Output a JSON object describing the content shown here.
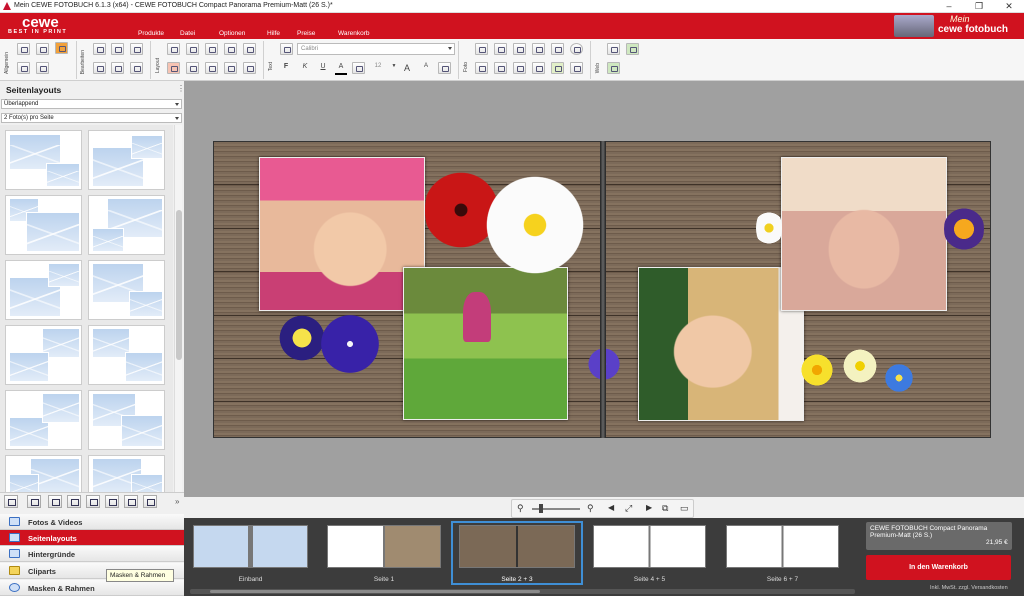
{
  "window": {
    "title": "Mein CEWE FOTOBUCH 6.1.3 (x64) - CEWE FOTOBUCH Compact Panorama Premium-Matt (26 S.)*",
    "minimize": "–",
    "maximize": "❐",
    "close": "✕"
  },
  "brand": {
    "name": "cewe",
    "tagline": "BEST IN PRINT",
    "mein": "Mein",
    "product": "cewe fotobuch",
    "accent": "#d0121f"
  },
  "menu": {
    "items": [
      {
        "label": "Produkte",
        "dropdown": false
      },
      {
        "label": "Datei",
        "dropdown": true
      },
      {
        "label": "Optionen",
        "dropdown": true
      },
      {
        "label": "Hilfe",
        "dropdown": false
      },
      {
        "label": "Preise",
        "dropdown": true
      },
      {
        "label": "Warenkorb",
        "dropdown": false
      }
    ]
  },
  "toolbar": {
    "groups": [
      "Allgemein",
      "Bearbeiten",
      "Layout",
      "Text",
      "Foto",
      "Web"
    ],
    "font_name": "Calibri",
    "font_size": "12",
    "bold": "F",
    "italic": "K",
    "underline": "U",
    "font_color": "A",
    "grow": "A",
    "shrink": "A"
  },
  "left_panel": {
    "title": "Seitenlayouts",
    "layout_mode": "Überlappend",
    "photos_per_page": "2 Foto(s) pro Seite"
  },
  "accordion": [
    {
      "label": "Fotos & Videos",
      "icon": "photos-icon",
      "active": false
    },
    {
      "label": "Seitenlayouts",
      "icon": "page-layouts-icon",
      "active": true
    },
    {
      "label": "Hintergründe",
      "icon": "backgrounds-icon",
      "active": false
    },
    {
      "label": "Cliparts",
      "icon": "cliparts-icon",
      "active": false
    },
    {
      "label": "Masken & Rahmen",
      "icon": "masks-frames-icon",
      "active": false
    }
  ],
  "tooltip": "Masken & Rahmen",
  "filmstrip": {
    "pages": [
      {
        "label": "Einband"
      },
      {
        "label": "Seite 1"
      },
      {
        "label": "Seite 2 + 3",
        "selected": true
      },
      {
        "label": "Seite 4 + 5"
      },
      {
        "label": "Seite 6 + 7"
      }
    ]
  },
  "cart": {
    "product": "CEWE FOTOBUCH Compact Panorama Premium-Matt (26 S.)",
    "price": "21,95 €",
    "button": "In den Warenkorb",
    "vat": "Inkl. MwSt. zzgl. Versandkosten"
  }
}
